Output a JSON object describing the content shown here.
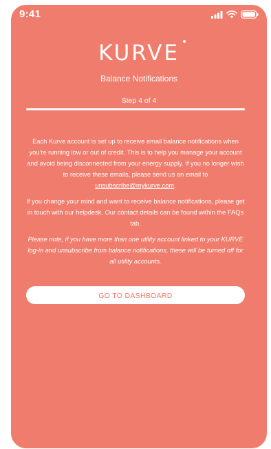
{
  "status_bar": {
    "time": "9:41",
    "icons": [
      "signal-icon",
      "wifi-icon",
      "battery-icon"
    ]
  },
  "brand": {
    "logo_text": "KURVE",
    "accent_color": "#ef7c6c"
  },
  "header": {
    "title": "Balance Notifications",
    "step": "Step 4 of 4",
    "progress": 1.0
  },
  "body": {
    "para1_text": "Each Kurve account is set up to receive email balance notifications when you're running low or out of credit. This is to help you manage your account and avoid being disconnected from your energy supply. If you no longer wish to receive these emails, please send us an email to ",
    "para1_link": "unsubscribe@mykurve.com",
    "para1_end": ".",
    "para2": "If you change your mind and want to receive balance notifications, please get in touch with our helpdesk. Our contact details can be found within the FAQs tab.",
    "note": "Please note, if you have more than one utility account linked to your KURVE log-in and unsubscribe from balance notifications, these will be turned off for all utility accounts."
  },
  "actions": {
    "dashboard_label": "GO TO DASHBOARD"
  }
}
